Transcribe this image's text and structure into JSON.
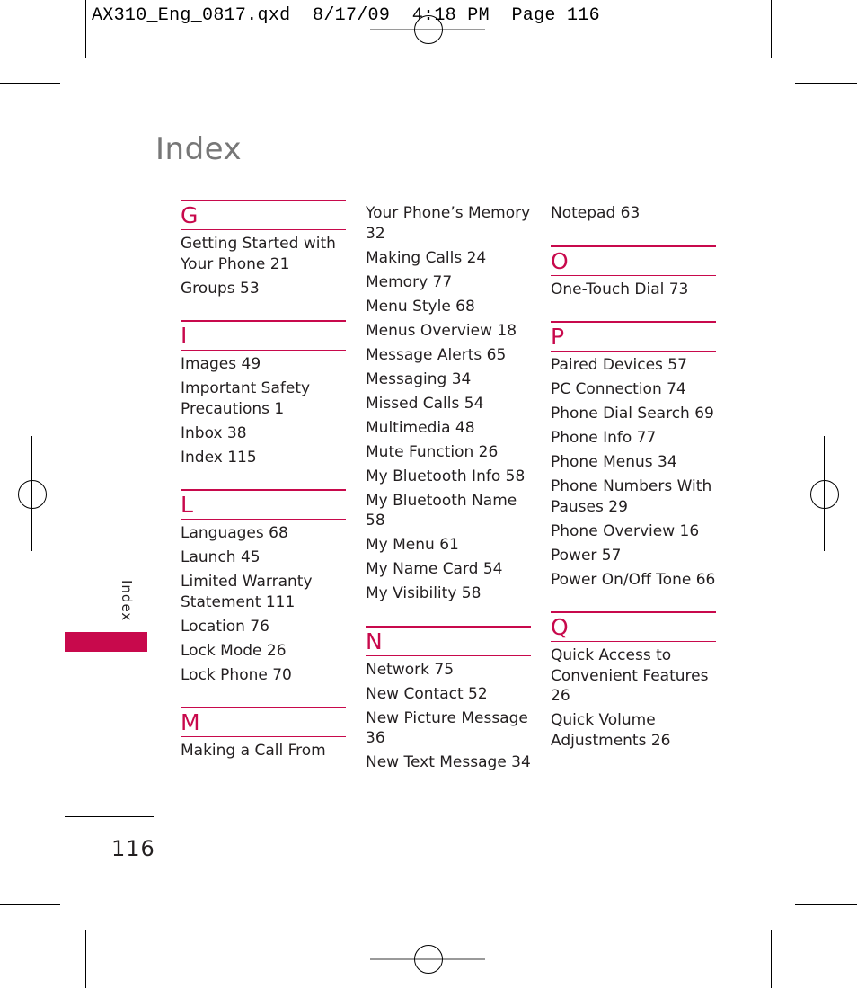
{
  "slug": "AX310_Eng_0817.qxd  8/17/09  4:18 PM  Page 116",
  "title": "Index",
  "side_tab": {
    "label": "Index",
    "color": "#c8094c"
  },
  "page_number": "116",
  "accent_color": "#c8094c",
  "columns": [
    [
      {
        "letter": "G",
        "entries": [
          "Getting Started with Your Phone 21",
          "Groups 53"
        ]
      },
      {
        "letter": "I",
        "entries": [
          "Images 49",
          "Important Safety Precautions 1",
          "Inbox 38",
          "Index 115"
        ]
      },
      {
        "letter": "L",
        "entries": [
          "Languages 68",
          "Launch 45",
          "Limited Warranty Statement 111",
          "Location 76",
          "Lock Mode 26",
          "Lock Phone 70"
        ]
      },
      {
        "letter": "M",
        "entries": [
          "Making a Call From"
        ]
      }
    ],
    [
      {
        "letter": "",
        "entries": [
          "Your Phone’s Memory 32",
          "Making Calls 24",
          "Memory 77",
          "Menu Style 68",
          "Menus Overview 18",
          "Message Alerts 65",
          "Messaging 34",
          "Missed Calls 54",
          "Multimedia 48",
          "Mute Function 26",
          "My Bluetooth Info 58",
          "My Bluetooth Name 58",
          "My Menu 61",
          "My Name Card 54",
          "My Visibility 58"
        ]
      },
      {
        "letter": "N",
        "entries": [
          "Network 75",
          "New Contact 52",
          "New Picture Message 36",
          "New Text Message 34"
        ]
      }
    ],
    [
      {
        "letter": "",
        "entries": [
          "Notepad 63"
        ]
      },
      {
        "letter": "O",
        "entries": [
          "One-Touch Dial 73"
        ]
      },
      {
        "letter": "P",
        "entries": [
          "Paired Devices 57",
          "PC Connection 74",
          "Phone Dial Search 69",
          "Phone Info 77",
          "Phone Menus 34",
          "Phone Numbers With Pauses 29",
          "Phone Overview 16",
          "Power 57",
          "Power On/Off Tone 66"
        ]
      },
      {
        "letter": "Q",
        "entries": [
          "Quick Access to Convenient Features 26",
          "Quick Volume Adjustments 26"
        ]
      }
    ]
  ]
}
